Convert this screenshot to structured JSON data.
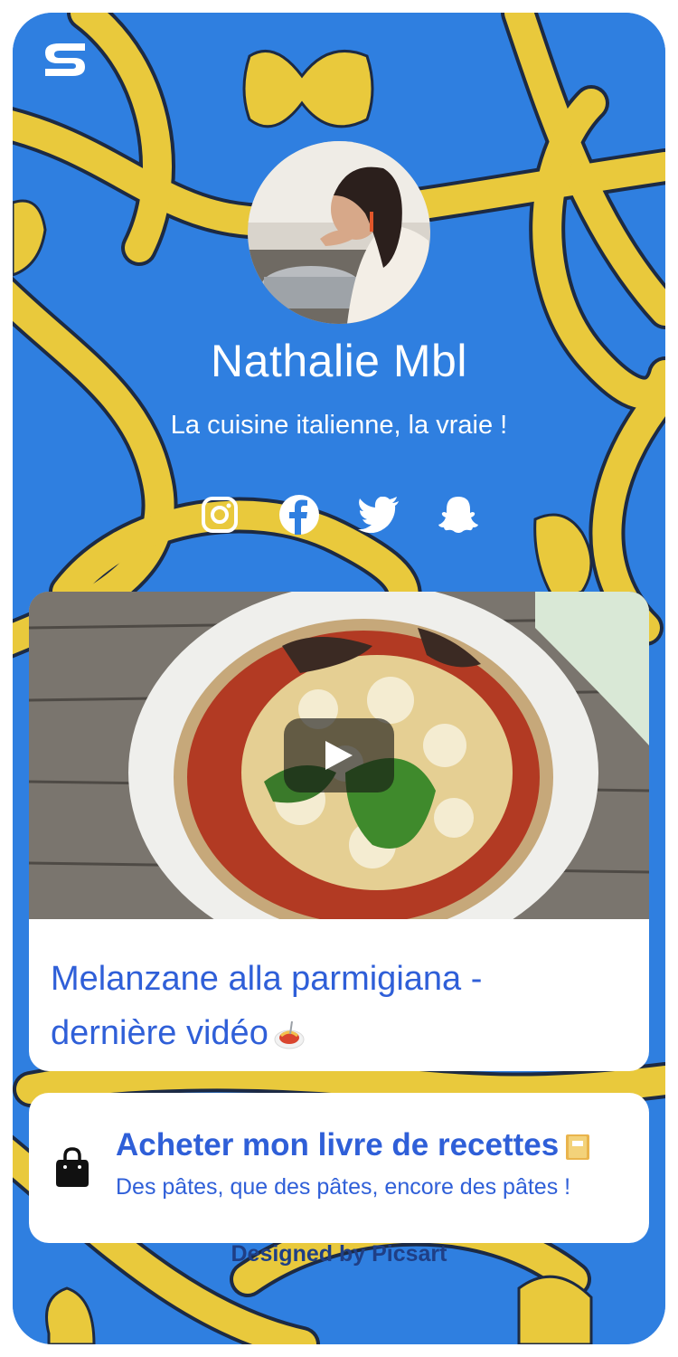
{
  "profile": {
    "name": "Nathalie Mbl",
    "bio": "La cuisine italienne, la vraie !"
  },
  "socials": [
    {
      "icon": "instagram-icon"
    },
    {
      "icon": "facebook-icon"
    },
    {
      "icon": "twitter-icon"
    },
    {
      "icon": "snapchat-icon"
    }
  ],
  "video_card": {
    "title_line1": "Melanzane alla parmigiana -",
    "title_line2": "dernière vidéo",
    "emoji": "spaghetti-icon"
  },
  "shop_card": {
    "title": "Acheter mon livre de recettes",
    "subtitle": "Des pâtes, que des pâtes, encore des pâtes !",
    "icon": "shopping-bag-icon",
    "emoji": "book-icon"
  },
  "footer": {
    "credit": "Designed by Picsart"
  },
  "colors": {
    "background": "#2f7fe0",
    "pasta": "#e9c93c",
    "accent": "#2f5fd8",
    "card": "#ffffff"
  }
}
